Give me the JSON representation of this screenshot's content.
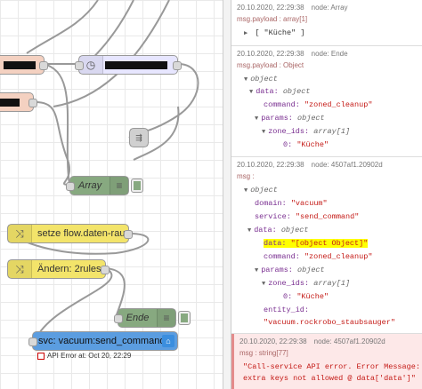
{
  "canvas": {
    "nodes": {
      "array": {
        "label": "Array"
      },
      "setze": {
        "label": "setze flow.daten-raum"
      },
      "aendern": {
        "label": "Ändern: 2rules"
      },
      "ende": {
        "label": "Ende"
      },
      "svc": {
        "label": "svc: vacuum:send_command"
      }
    },
    "status": {
      "error_text": "API Error at: Oct 20, 22:29"
    },
    "colors": {
      "change_node": "#f3e46a",
      "debug_node": "#87a980",
      "service_node": "#4f8fd6",
      "function_node": "#f4d1c1",
      "trigger_node": "#e7e6ff"
    }
  },
  "debug": {
    "messages": [
      {
        "time": "20.10.2020, 22:29:38",
        "node": "node: Array",
        "topic": "msg.payload : array[1]",
        "tree": {
          "caret": "▶",
          "value": "[ \"Küche\" ]"
        }
      },
      {
        "time": "20.10.2020, 22:29:38",
        "node": "node: Ende",
        "topic": "msg.payload : Object",
        "tree": {
          "root_type": "object",
          "data_key": "data:",
          "data_type": "object",
          "command_key": "command:",
          "command_val": "\"zoned_cleanup\"",
          "params_key": "params:",
          "params_type": "object",
          "zone_key": "zone_ids:",
          "zone_type": "array[1]",
          "idx_key": "0:",
          "idx_val": "\"Küche\""
        }
      },
      {
        "time": "20.10.2020, 22:29:38",
        "node": "node: 4507af1.20902d",
        "topic": "msg :",
        "tree": {
          "root_type": "object",
          "domain_key": "domain:",
          "domain_val": "\"vacuum\"",
          "service_key": "service:",
          "service_val": "\"send_command\"",
          "data_key": "data:",
          "data_type": "object",
          "data2_key": "data:",
          "data2_val": "\"[object Object]\"",
          "command_key": "command:",
          "command_val": "\"zoned_cleanup\"",
          "params_key": "params:",
          "params_type": "object",
          "zone_key": "zone_ids:",
          "zone_type": "array[1]",
          "idx_key": "0:",
          "idx_val": "\"Küche\"",
          "entity_key": "entity_id:",
          "entity_val": "\"vacuum.rockrobo_staubsauger\""
        }
      },
      {
        "time": "20.10.2020, 22:29:38",
        "node": "node: 4507af1.20902d",
        "topic": "msg : string[77]",
        "error_line1": "\"Call-service API error.  Error Message:",
        "error_line2": "extra keys not allowed @ data['data']\""
      }
    ]
  }
}
